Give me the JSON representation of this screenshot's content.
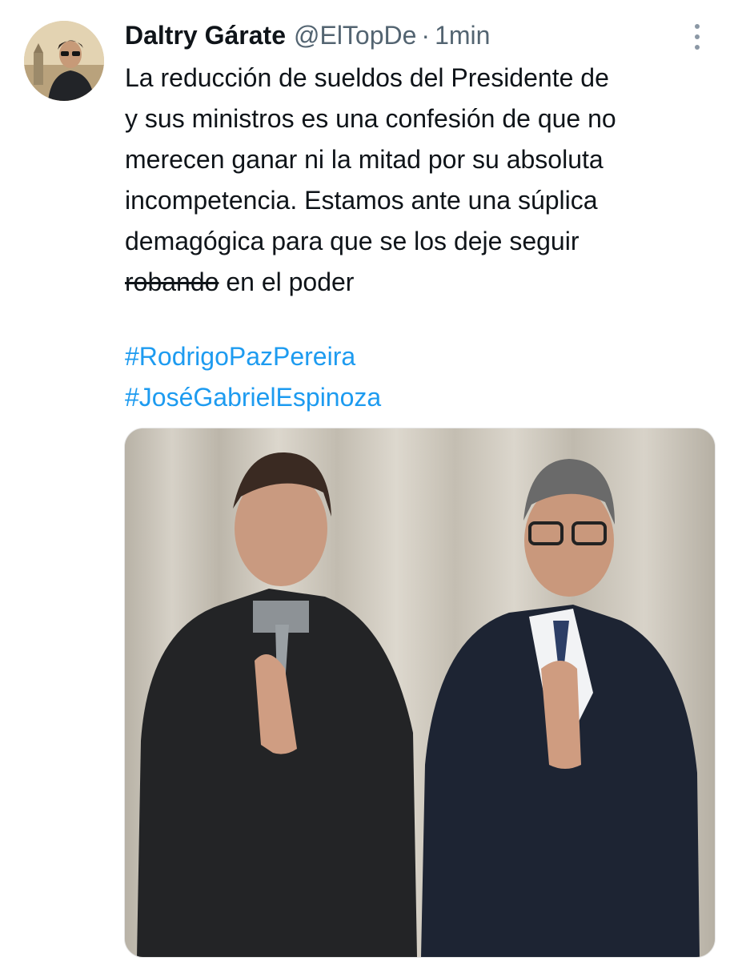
{
  "tweet": {
    "author": {
      "display_name": "Daltry Gárate",
      "handle": "@ElTopDe",
      "separator": "·",
      "time": "1min"
    },
    "text_lines": [
      "La reducción de sueldos del Presidente de",
      "y sus ministros es una confesión de que no",
      "merecen ganar ni la mitad por su absoluta",
      "incompetencia. Estamos ante una súplica",
      "demagógica para que se los deje seguir"
    ],
    "last_line": {
      "struck": "robando",
      "rest": " en el poder"
    },
    "hashtags": [
      "#RodrigoPazPereira",
      "#JoséGabrielEspinoza"
    ]
  },
  "icons": {
    "more": "more-vertical-icon"
  },
  "colors": {
    "text": "#0f1419",
    "secondary": "#536471",
    "link": "#1d9bf0",
    "background": "#ffffff"
  }
}
